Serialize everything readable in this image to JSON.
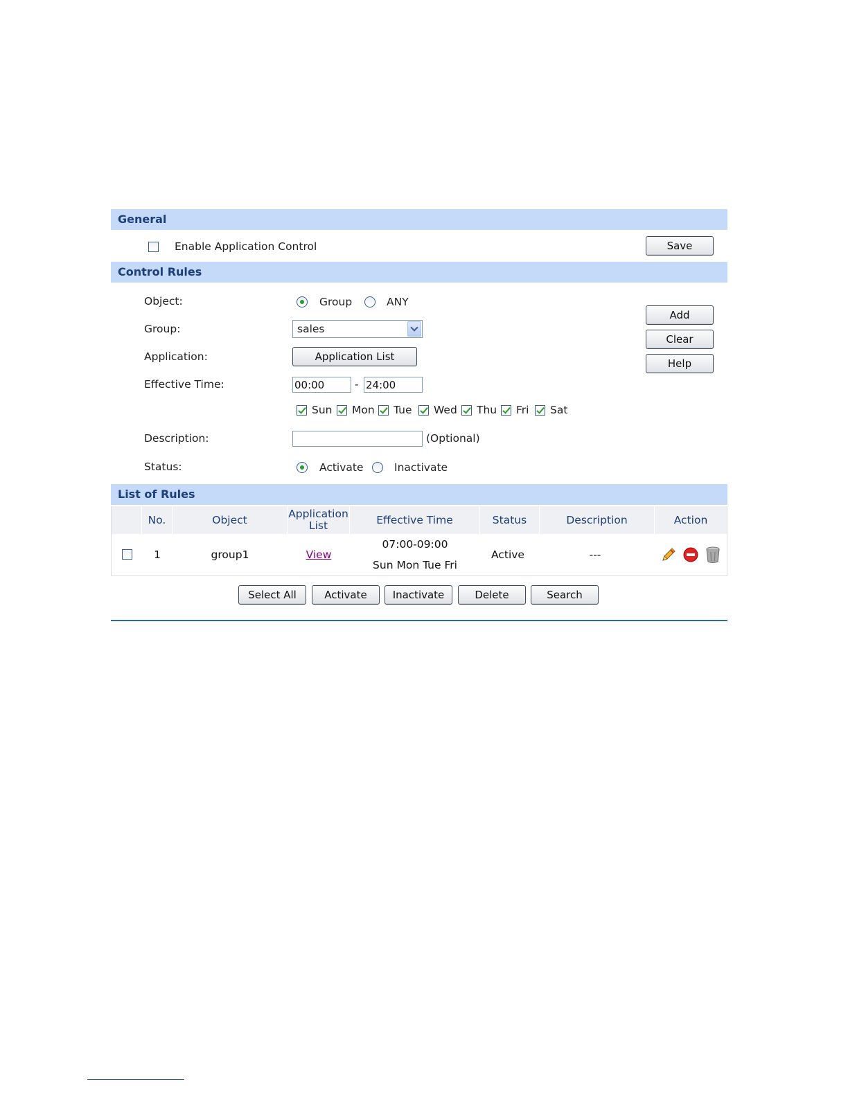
{
  "general": {
    "header": "General",
    "enable_label": "Enable Application Control",
    "save_label": "Save"
  },
  "control_rules": {
    "header": "Control Rules",
    "object_label": "Object:",
    "object_options": [
      "Group",
      "ANY"
    ],
    "object_selected": "Group",
    "group_label": "Group:",
    "group_value": "sales",
    "application_label": "Application:",
    "application_button": "Application List",
    "effective_time_label": "Effective Time:",
    "time_start": "00:00",
    "time_separator": "-",
    "time_end": "24:00",
    "days": [
      "Sun",
      "Mon",
      "Tue",
      "Wed",
      "Thu",
      "Fri",
      "Sat"
    ],
    "description_label": "Description:",
    "description_value": "",
    "optional_text": "(Optional)",
    "status_label": "Status:",
    "status_options": [
      "Activate",
      "Inactivate"
    ],
    "status_selected": "Activate",
    "add_label": "Add",
    "clear_label": "Clear",
    "help_label": "Help"
  },
  "list_of_rules": {
    "header": "List of Rules",
    "columns": [
      "No.",
      "Object",
      "Application List",
      "Effective Time",
      "Status",
      "Description",
      "Action"
    ],
    "rows": [
      {
        "no": "1",
        "object": "group1",
        "application_list": "View",
        "effective_time": "07:00-09:00",
        "effective_days": "Sun Mon Tue Fri",
        "status": "Active",
        "description": "---",
        "actions": [
          "edit-icon",
          "disable-icon",
          "delete-icon"
        ]
      }
    ],
    "buttons": {
      "select_all": "Select All",
      "activate": "Activate",
      "inactivate": "Inactivate",
      "delete": "Delete",
      "search": "Search"
    }
  },
  "colors": {
    "section_header_bg": "#c5d9f9",
    "section_header_text": "#1d3f79",
    "check_green": "#2a9d2a",
    "link_purple": "#800080",
    "rule_line": "#2e6da4"
  }
}
